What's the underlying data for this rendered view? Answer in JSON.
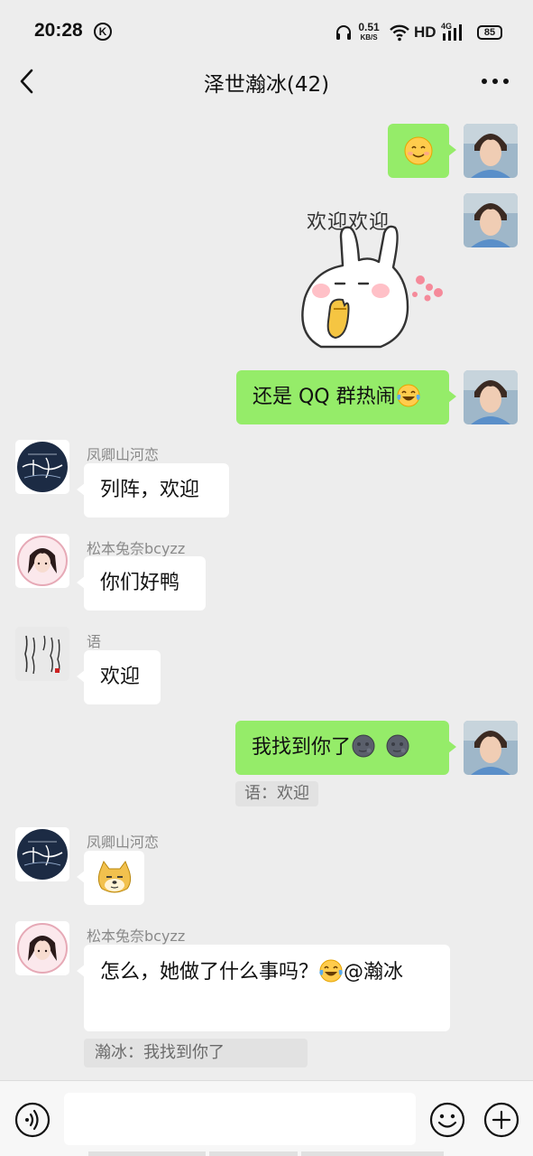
{
  "status_bar": {
    "time": "20:28",
    "k_badge": "K",
    "net_speed": "0.51",
    "net_unit": "KB/S",
    "hd": "HD",
    "signal_label": "4G",
    "battery": "85"
  },
  "header": {
    "title": "泽世瀚冰(42)",
    "back_icon": "chevron-left-icon",
    "more_icon": "more-dots-icon"
  },
  "messages": [
    {
      "from": "self",
      "type": "emoji",
      "emoji": "smiling-face-emoji"
    },
    {
      "from": "self",
      "type": "sticker",
      "sticker_text": "欢迎欢迎"
    },
    {
      "from": "self",
      "type": "text",
      "text": "还是 QQ 群热闹",
      "emoji": "tears-of-joy-emoji"
    },
    {
      "from": "other",
      "sender": "凤卿山河恋",
      "type": "text",
      "text": "列阵，欢迎"
    },
    {
      "from": "other",
      "sender": "松本兔奈bcyzz",
      "type": "text",
      "text": "你们好鸭"
    },
    {
      "from": "other",
      "sender": "语",
      "type": "text",
      "text": "欢迎"
    },
    {
      "from": "self",
      "type": "text",
      "text": "我找到你了",
      "emoji": "new-moon-face-emoji",
      "quote": "语：欢迎"
    },
    {
      "from": "other",
      "sender": "凤卿山河恋",
      "type": "emoji",
      "emoji": "doge-emoji"
    },
    {
      "from": "other",
      "sender": "松本兔奈bcyzz",
      "type": "text",
      "text": "怎么，她做了什么事吗？",
      "emoji": "tears-of-joy-emoji",
      "mention": "@瀚冰",
      "quote": "瀚冰：我找到你了"
    }
  ],
  "input_bar": {
    "placeholder": "",
    "voice_icon": "voice-icon",
    "emoji_icon": "emoji-smile-icon",
    "plus_icon": "plus-circle-icon"
  },
  "colors": {
    "background": "#ededed",
    "self_bubble": "#95ec69",
    "other_bubble": "#ffffff",
    "sender_name": "#8a8a8a"
  }
}
